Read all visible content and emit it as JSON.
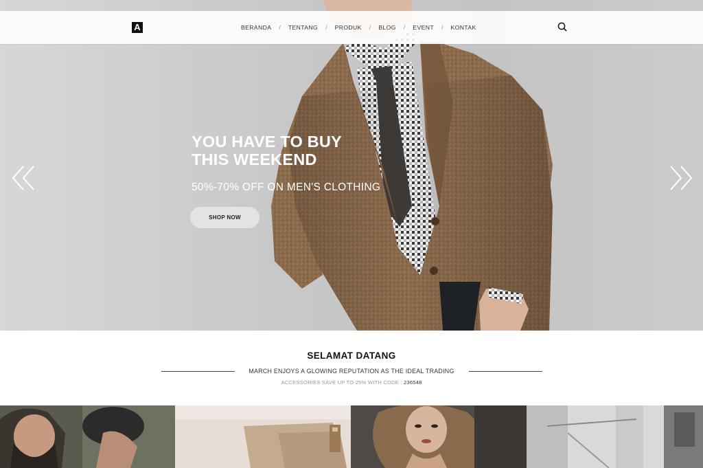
{
  "brand": {
    "logo_letter": "A"
  },
  "nav": {
    "items": [
      {
        "label": "BERANDA"
      },
      {
        "label": "TENTANG"
      },
      {
        "label": "PRODUK"
      },
      {
        "label": "BLOG"
      },
      {
        "label": "EVENT"
      },
      {
        "label": "KONTAK"
      }
    ],
    "separator": "/",
    "search_icon": "search-icon"
  },
  "hero": {
    "title_line1": "YOU HAVE TO BUY",
    "title_line2": "THIS WEEKEND",
    "subtitle": "50%-70% OFF ON MEN'S CLOTHING",
    "button_label": "SHOP NOW",
    "prev_icon": "double-chevron-left-icon",
    "next_icon": "double-chevron-right-icon"
  },
  "welcome": {
    "title": "SELAMAT DATANG",
    "tagline": "MARCH ENJOYS A GLOWING REPUTATION AS THE IDEAL TRADING",
    "promo_text": "ACCESSORIES SAVE UP TO 25% WITH CODE : ",
    "promo_code": "236548"
  },
  "gallery": {
    "tiles": [
      {
        "name": "bearded-man-photo"
      },
      {
        "name": "leather-bag-photo"
      },
      {
        "name": "woman-portrait-photo"
      },
      {
        "name": "interior-photo"
      }
    ]
  },
  "colors": {
    "hero_background": "#c8c8c8",
    "nav_background": "#ffffff",
    "text_dark": "#222222",
    "text_muted": "#999999",
    "button_background": "#e3e3e3"
  }
}
